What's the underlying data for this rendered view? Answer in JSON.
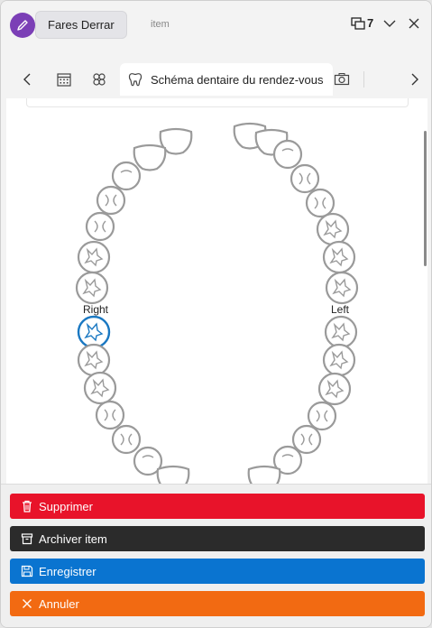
{
  "titlebar": {
    "user_name": "Fares Derrar",
    "item_label": "item",
    "window_count": "7",
    "avatar_icon": "pencil-icon"
  },
  "tabs": {
    "active_label": "Schéma dentaire du rendez-vous",
    "icons": [
      "chevron-left-icon",
      "calendar-icon",
      "molecule-icon",
      "tooth-icon",
      "camera-icon",
      "chevron-right-icon"
    ]
  },
  "chart": {
    "right_label": "Right",
    "left_label": "Left",
    "selected_tooth": "right-upper-8",
    "colors": {
      "tooth_stroke": "#9a9a9a",
      "selected_stroke": "#1a78c2"
    }
  },
  "actions": [
    {
      "label": "Supprimer",
      "icon": "trash-icon",
      "color": "#e8132a"
    },
    {
      "label": "Archiver item",
      "icon": "archive-icon",
      "color": "#2b2b2b"
    },
    {
      "label": "Enregistrer",
      "icon": "save-icon",
      "color": "#0a74d0"
    },
    {
      "label": "Annuler",
      "icon": "close-icon",
      "color": "#f26a12"
    }
  ]
}
